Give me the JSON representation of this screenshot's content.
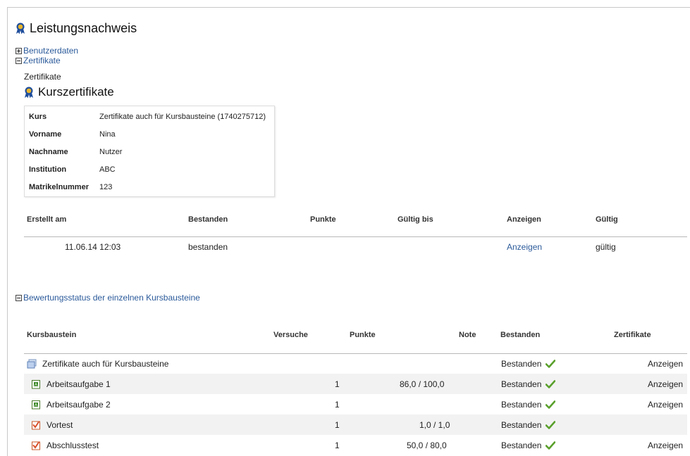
{
  "page": {
    "title": "Leistungsnachweis"
  },
  "tree": {
    "user_data_label": "Benutzerdaten",
    "certificates_label": "Zertifikate",
    "evaluation_label": "Bewertungsstatus der einzelnen Kursbausteine"
  },
  "certificates_section": {
    "small_label": "Zertifikate",
    "title": "Kurszertifikate",
    "info": [
      {
        "key": "Kurs",
        "value": "Zertifikate auch für Kursbausteine (1740275712)"
      },
      {
        "key": "Vorname",
        "value": "Nina"
      },
      {
        "key": "Nachname",
        "value": "Nutzer"
      },
      {
        "key": "Institution",
        "value": "ABC"
      },
      {
        "key": "Matrikelnummer",
        "value": "123"
      }
    ],
    "table": {
      "headers": [
        "Erstellt am",
        "Bestanden",
        "Punkte",
        "Gültig bis",
        "Anzeigen",
        "Gültig"
      ],
      "row": {
        "created": "11.06.14 12:03",
        "passed": "bestanden",
        "points": "",
        "valid_until": "",
        "show": "Anzeigen",
        "valid": "gültig"
      }
    }
  },
  "evaluation": {
    "headers": [
      "Kursbaustein",
      "Versuche",
      "Punkte",
      "Note",
      "Bestanden",
      "Zertifikate"
    ],
    "rows": [
      {
        "icon": "course-icon",
        "name": "Zertifikate auch für Kursbausteine",
        "attempts": "",
        "points": "",
        "grade": "",
        "passed": "Bestanden",
        "cert": "Anzeigen"
      },
      {
        "icon": "assignment-icon",
        "name": "Arbeitsaufgabe 1",
        "attempts": "1",
        "points": "86,0 / 100,0",
        "grade": "",
        "passed": "Bestanden",
        "cert": "Anzeigen"
      },
      {
        "icon": "assignment-icon",
        "name": "Arbeitsaufgabe 2",
        "attempts": "1",
        "points": "",
        "grade": "",
        "passed": "Bestanden",
        "cert": "Anzeigen"
      },
      {
        "icon": "test-icon",
        "name": "Vortest",
        "attempts": "1",
        "points": "1,0 / 1,0",
        "grade": "",
        "passed": "Bestanden",
        "cert": ""
      },
      {
        "icon": "test-icon",
        "name": "Abschlusstest",
        "attempts": "1",
        "points": "50,0 / 80,0",
        "grade": "",
        "passed": "Bestanden",
        "cert": "Anzeigen"
      }
    ]
  },
  "colors": {
    "link": "#2b5a9a",
    "passed": "#3a8a1e",
    "check": "#5aa02c",
    "award_blue": "#1f4e9c",
    "award_gold": "#e8b42a"
  }
}
